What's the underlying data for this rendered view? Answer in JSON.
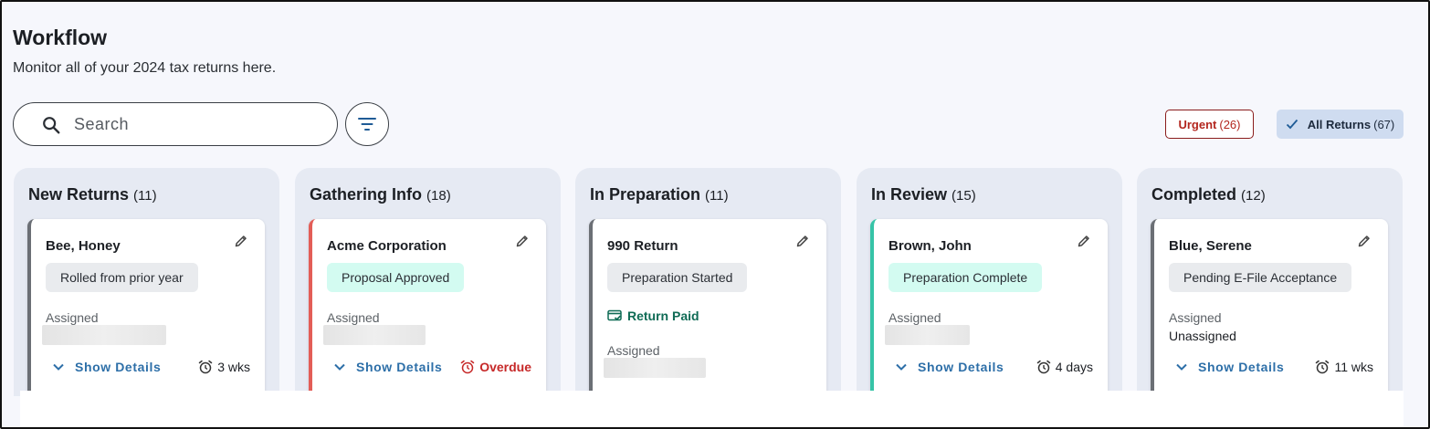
{
  "header": {
    "title": "Workflow",
    "subtitle": "Monitor all of your 2024 tax returns here."
  },
  "search": {
    "placeholder": "Search"
  },
  "filters": {
    "urgent": {
      "label": "Urgent",
      "count": "(26)"
    },
    "all_returns": {
      "label": "All Returns",
      "count": "(67)"
    }
  },
  "icons": {
    "search": "search-icon",
    "filter": "filter-icon",
    "check": "check-icon",
    "edit": "pencil-icon",
    "chevron": "chevron-down-icon",
    "alarm": "alarm-clock-icon",
    "paid": "credit-card-check-icon"
  },
  "colors": {
    "accent": "#2d6fa8",
    "urgent": "#b3261e",
    "paid": "#0f6b55",
    "card_border_default": "#6b6f75",
    "card_border_red": "#e35d57",
    "card_border_teal": "#36c4a7"
  },
  "common": {
    "assigned_label": "Assigned",
    "show_details": "Show Details"
  },
  "columns": [
    {
      "title": "New Returns",
      "count": "(11)",
      "card": {
        "name": "Bee, Honey",
        "status": "Rolled from prior year",
        "time": "3 wks"
      }
    },
    {
      "title": "Gathering Info",
      "count": "(18)",
      "card": {
        "name": "Acme Corporation",
        "status": "Proposal Approved",
        "time": "Overdue"
      }
    },
    {
      "title": "In Preparation",
      "count": "(11)",
      "card": {
        "name": "990 Return",
        "status": "Preparation Started",
        "payment": "Return Paid"
      }
    },
    {
      "title": "In Review",
      "count": "(15)",
      "card": {
        "name": "Brown, John",
        "status": "Preparation Complete",
        "time": "4 days"
      }
    },
    {
      "title": "Completed",
      "count": "(12)",
      "card": {
        "name": "Blue, Serene",
        "status": "Pending E-File Acceptance",
        "assigned_value": "Unassigned",
        "time": "11 wks"
      }
    }
  ]
}
